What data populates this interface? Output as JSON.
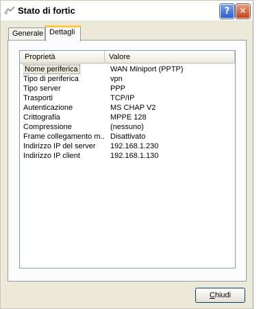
{
  "window": {
    "title": "Stato di fortic",
    "help_glyph": "?",
    "close_glyph": "✕"
  },
  "tabs": [
    {
      "label": "Generale",
      "active": false
    },
    {
      "label": "Dettagli",
      "active": true
    }
  ],
  "list": {
    "columns": [
      "Proprietà",
      "Valore"
    ],
    "rows": [
      {
        "property": "Nome periferica",
        "value": "WAN Miniport (PPTP)",
        "selected": true
      },
      {
        "property": "Tipo di periferica",
        "value": "vpn"
      },
      {
        "property": "Tipo server",
        "value": "PPP"
      },
      {
        "property": "Trasporti",
        "value": "TCP/IP"
      },
      {
        "property": "Autenticazione",
        "value": "MS CHAP V2"
      },
      {
        "property": "Crittografia",
        "value": "MPPE 128"
      },
      {
        "property": "Compressione",
        "value": "(nessuno)"
      },
      {
        "property": "Frame collegamento m...",
        "value": "Disattivato"
      },
      {
        "property": "Indirizzo IP del server",
        "value": "192.168.1.230"
      },
      {
        "property": "Indirizzo IP client",
        "value": "192.168.1.130"
      }
    ]
  },
  "buttons": {
    "close_label_accel": "C",
    "close_label_rest": "hiudi"
  },
  "icons": {
    "title": "network-connection-icon",
    "help": "help-icon",
    "close": "close-icon"
  },
  "colors": {
    "selection_border": "#555555",
    "tab_highlight": "#ffc83c",
    "close_red": "#c8401e",
    "help_blue": "#2c5fd0"
  }
}
